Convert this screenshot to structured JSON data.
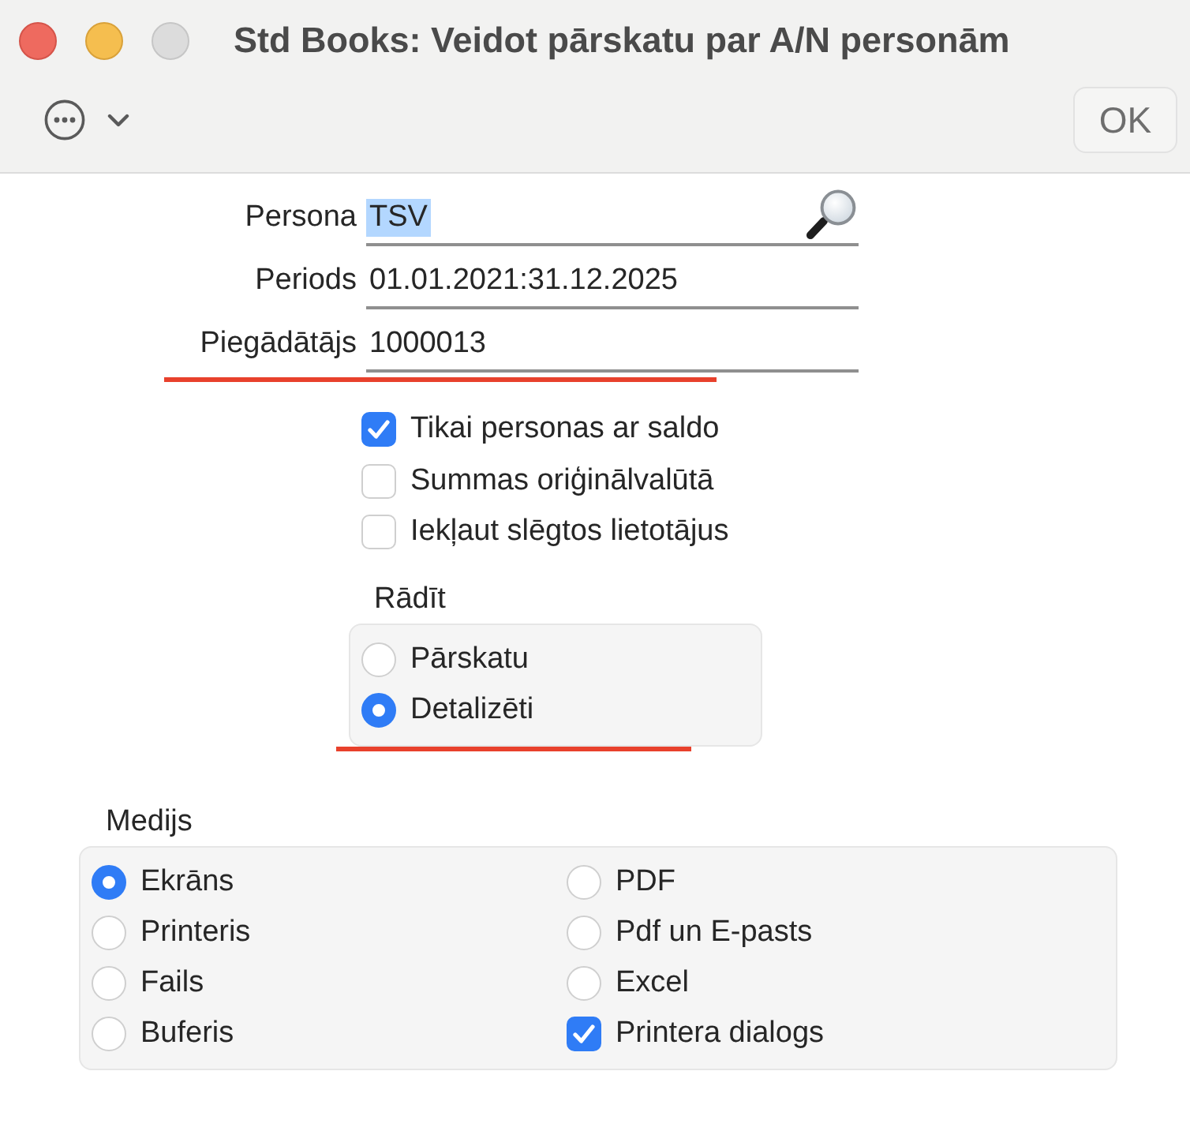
{
  "window": {
    "title": "Std Books: Veidot pārskatu par A/N personām",
    "buttons": [
      {
        "kind": "close",
        "disabled": false
      },
      {
        "kind": "minimize",
        "disabled": false
      },
      {
        "kind": "zoom",
        "disabled": true
      }
    ]
  },
  "toolbar": {
    "ok_button": "OK"
  },
  "fields": [
    {
      "label": "Persona",
      "value": "TSV",
      "text_selected": true,
      "lookup": true,
      "highlighted": false
    },
    {
      "label": "Periods",
      "value": "01.01.2021:31.12.2025",
      "text_selected": false,
      "lookup": false,
      "highlighted": false
    },
    {
      "label": "Piegādātājs",
      "value": "1000013",
      "text_selected": false,
      "lookup": false,
      "highlighted": true
    }
  ],
  "checkboxes": [
    {
      "label": "Tikai personas ar saldo",
      "checked": true
    },
    {
      "label": "Summas oriģinālvalūtā",
      "checked": false
    },
    {
      "label": "Iekļaut slēgtos lietotājus",
      "checked": false
    }
  ],
  "show_group": {
    "title": "Rādīt",
    "highlighted": true,
    "options": [
      {
        "label": "Pārskatu",
        "selected": false
      },
      {
        "label": "Detalizēti",
        "selected": true
      }
    ]
  },
  "media_group": {
    "title": "Medijs",
    "columns": [
      [
        {
          "kind": "radio",
          "label": "Ekrāns",
          "selected": true
        },
        {
          "kind": "radio",
          "label": "Printeris",
          "selected": false
        },
        {
          "kind": "radio",
          "label": "Fails",
          "selected": false
        },
        {
          "kind": "radio",
          "label": "Buferis",
          "selected": false
        }
      ],
      [
        {
          "kind": "radio",
          "label": "PDF",
          "selected": false
        },
        {
          "kind": "radio",
          "label": "Pdf un E-pasts",
          "selected": false
        },
        {
          "kind": "radio",
          "label": "Excel",
          "selected": false
        },
        {
          "kind": "checkbox",
          "label": "Printera dialogs",
          "selected": true
        }
      ]
    ]
  }
}
